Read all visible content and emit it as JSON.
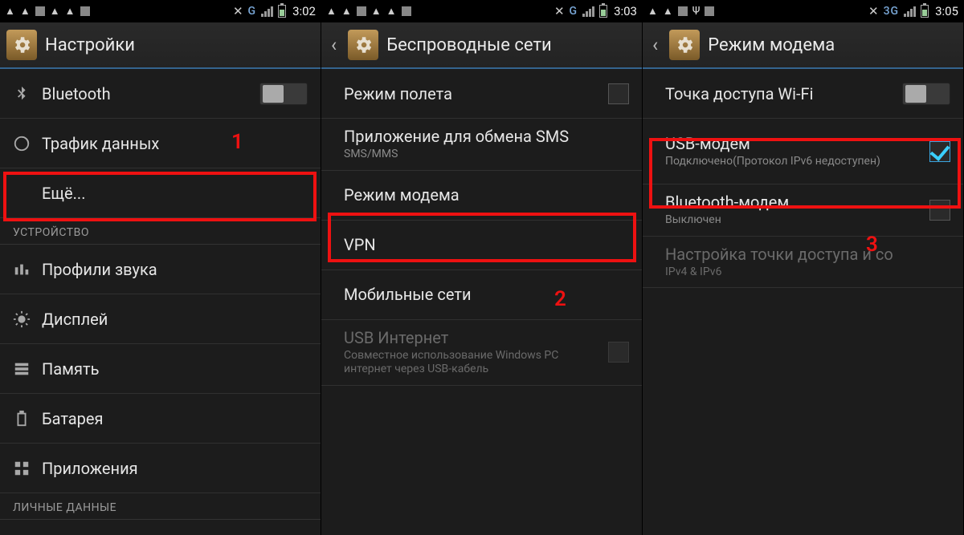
{
  "screens": [
    {
      "status": {
        "net": "G",
        "time": "3:02",
        "icons": [
          "warn",
          "warn",
          "box",
          "warn",
          "warn",
          "box"
        ],
        "usb": false
      },
      "header": {
        "back": false,
        "title": "Настройки"
      },
      "annotation": "1",
      "sections": [
        {
          "header": null,
          "rows": [
            {
              "icon": "bluetooth",
              "title": "Bluetooth",
              "toggle": "off"
            },
            {
              "icon": "data",
              "title": "Трафик данных"
            },
            {
              "icon": "",
              "title": "Ещё...",
              "highlight": true
            }
          ]
        },
        {
          "header": "УСТРОЙСТВО",
          "rows": [
            {
              "icon": "audio",
              "title": "Профили звука"
            },
            {
              "icon": "display",
              "title": "Дисплей"
            },
            {
              "icon": "storage",
              "title": "Память"
            },
            {
              "icon": "battery",
              "title": "Батарея"
            },
            {
              "icon": "apps",
              "title": "Приложения"
            }
          ]
        },
        {
          "header": "ЛИЧНЫЕ ДАННЫЕ",
          "rows": []
        }
      ]
    },
    {
      "status": {
        "net": "G",
        "time": "3:03",
        "icons": [
          "warn",
          "warn",
          "box",
          "warn",
          "warn",
          "box"
        ],
        "usb": false
      },
      "header": {
        "back": true,
        "title": "Беспроводные сети"
      },
      "annotation": "2",
      "rows": [
        {
          "title": "Режим полета",
          "checkbox": "off"
        },
        {
          "title": "Приложение для обмена SMS",
          "sub": "SMS/MMS"
        },
        {
          "title": "Режим модема",
          "highlight": true
        },
        {
          "title": "VPN"
        },
        {
          "title": "Мобильные сети"
        },
        {
          "title": "USB Интернет",
          "sub": "Совместное использование Windows PC интернет через USB-кабель",
          "checkbox": "off",
          "disabled": true
        }
      ]
    },
    {
      "status": {
        "net": "3G",
        "time": "3:05",
        "icons": [
          "warn",
          "warn",
          "box",
          "usb",
          "box"
        ],
        "usb": true
      },
      "header": {
        "back": true,
        "title": "Режим модема"
      },
      "annotation": "3",
      "rows": [
        {
          "title": "Точка доступа Wi-Fi",
          "toggle": "off"
        },
        {
          "title": "USB-модем",
          "sub": "Подключено(Протокол IPv6 недоступен)",
          "checkbox": "on",
          "highlight": true
        },
        {
          "title": "Bluetooth-модем",
          "sub": "Выключен",
          "checkbox": "off"
        },
        {
          "title": "Настройка точки доступа и со",
          "sub": "IPv4 & IPv6",
          "disabled": true
        }
      ]
    }
  ]
}
